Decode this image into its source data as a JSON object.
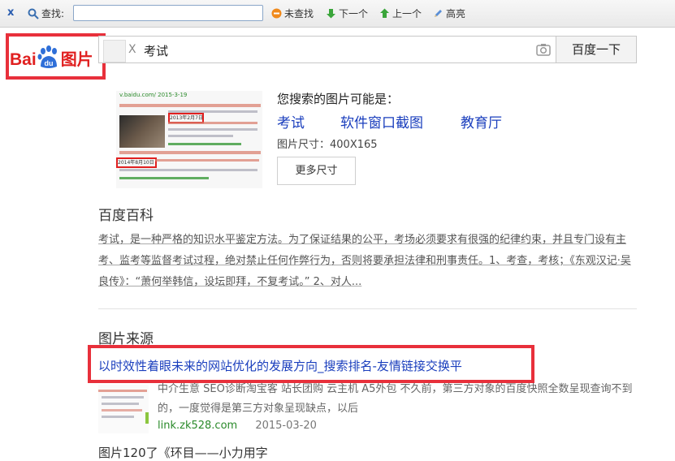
{
  "findbar": {
    "close_label": "x",
    "find_label": "查找:",
    "input_value": "",
    "not_found_label": "未查找",
    "next_label": "下一个",
    "prev_label": "上一个",
    "highlight_label": "高亮"
  },
  "logo": {
    "bai": "Bai",
    "du": "du",
    "pic": "图片"
  },
  "search": {
    "clear": "X",
    "query": "考试",
    "button": "百度一下"
  },
  "result": {
    "maybe_title": "您搜索的图片可能是：",
    "tags": [
      "考试",
      "软件窗口截图",
      "教育厅"
    ],
    "size_label": "图片尺寸：400X165",
    "more_sizes": "更多尺寸"
  },
  "preview": {
    "url": "v.baidu.com/ 2015-3-19",
    "date1": "2013年2月7日",
    "date2": "2014年8月10日"
  },
  "baike": {
    "heading": "百度百科",
    "text": "考试，是一种严格的知识水平鉴定方法。为了保证结果的公平，考场必须要求有很强的纪律约束，并且专门设有主考、监考等监督考试过程，绝对禁止任何作弊行为，否则将要承担法律和刑事责任。1、考查，考核；《东观汉记·吴良传》：“萧何举韩信，设坛即拜，不复考试。” 2、对人..."
  },
  "source": {
    "heading": "图片来源",
    "title": "以时效性着眼未来的网站优化的发展方向_搜索排名-友情链接交换平",
    "desc": "中介生意 SEO诊断淘宝客 站长团购 云主机 A5外包 不久前，第三方对象的百度快照全数呈现查询不到的，一度觉得是第三方对象呈现缺点，以后",
    "url": "link.zk528.com",
    "date": "2015-03-20",
    "next_title": "图片120了《环目——小力用字"
  },
  "colors": {
    "accent_red": "#e8303b",
    "link_blue": "#1a3ebd",
    "url_green": "#2a8a2a"
  }
}
